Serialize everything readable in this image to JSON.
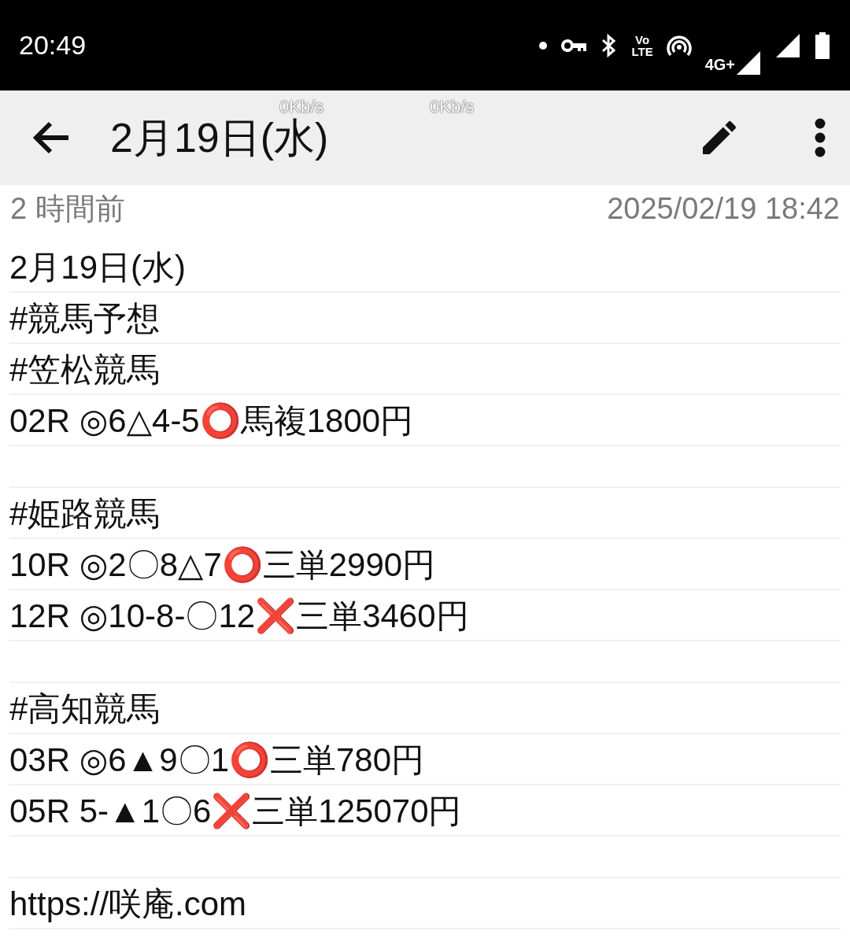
{
  "status_bar": {
    "time": "20:49",
    "volte": [
      "Vo",
      "LTE"
    ],
    "network": "4G+"
  },
  "speed_overlays": [
    "0Kb/s",
    "0Kb/s"
  ],
  "app_bar": {
    "title": "2月19日(水)"
  },
  "meta": {
    "relative_time": "2 時間前",
    "timestamp": "2025/02/19 18:42"
  },
  "note_blocks": [
    {
      "lines": [
        "2月19日(水)",
        "#競馬予想",
        "#笠松競馬",
        "02R ◎6△4-5⭕馬複1800円"
      ]
    },
    {
      "lines": [
        "#姫路競馬",
        "10R ◎2〇8△7⭕三単2990円",
        "12R ◎10-8-〇12❌三単3460円"
      ]
    },
    {
      "lines": [
        "#高知競馬",
        "03R ◎6▲9〇1⭕三単780円",
        "05R 5-▲1〇6❌三単125070円"
      ]
    },
    {
      "lines": [
        "https://咲庵.com"
      ]
    }
  ]
}
